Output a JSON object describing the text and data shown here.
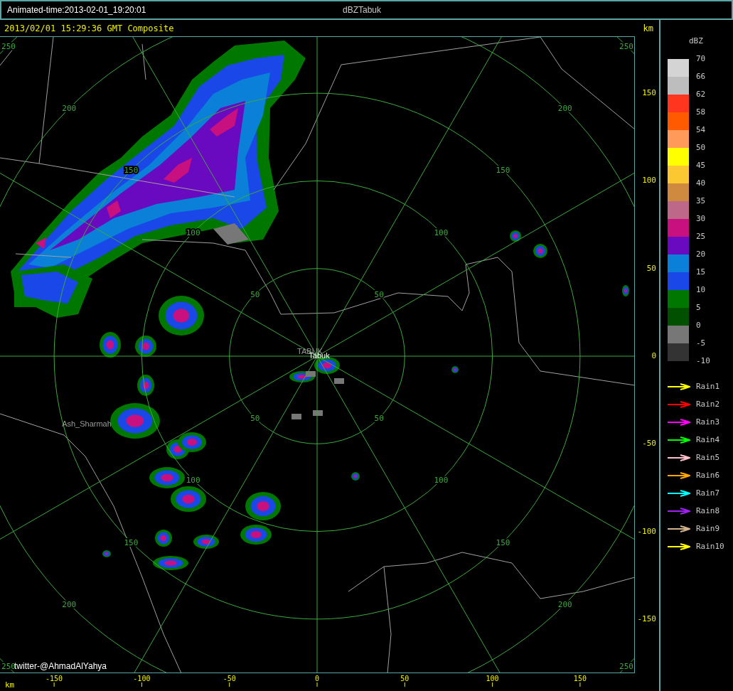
{
  "window": {
    "title": "Animated-time:2013-02-01_19:20:01",
    "product": "dBZTabuk"
  },
  "header": {
    "timestamp": "2013/02/01 15:29:36 GMT Composite",
    "unit": "km"
  },
  "map": {
    "range_rings": [
      {
        "labels": [
          "50",
          "50",
          "50",
          "50"
        ]
      },
      {
        "labels": [
          "100",
          "100",
          "100",
          "100"
        ]
      },
      {
        "labels": [
          "150",
          "150",
          "150",
          "150"
        ]
      },
      {
        "labels": [
          "200",
          "200",
          "200",
          "200"
        ]
      },
      {
        "labels": [
          "250",
          "250",
          "250",
          "250"
        ]
      }
    ],
    "places": [
      {
        "name": "TABUK"
      },
      {
        "name": "Tabuk"
      },
      {
        "name": "Ash_Sharmah"
      }
    ],
    "credit": "twitter-@AhmadAlYahya"
  },
  "x_axis": {
    "unit": "km",
    "ticks": [
      "-150",
      "-100",
      "-50",
      "0",
      "50",
      "100",
      "150"
    ]
  },
  "y_axis": {
    "ticks": [
      "150",
      "100",
      "50",
      "0",
      "-50",
      "-100",
      "-150"
    ]
  },
  "legend": {
    "title": "dBZ",
    "bands": [
      {
        "color": "#d4d4d4"
      },
      {
        "color": "#bdbdbd"
      },
      {
        "color": "#ff3520"
      },
      {
        "color": "#ff5a00"
      },
      {
        "color": "#ff9a5a"
      },
      {
        "color": "#ffff00"
      },
      {
        "color": "#fcc832"
      },
      {
        "color": "#d08a40"
      },
      {
        "color": "#bd6888"
      },
      {
        "color": "#c8107e"
      },
      {
        "color": "#6a0ac0"
      },
      {
        "color": "#0a80d8"
      },
      {
        "color": "#1a48e8"
      },
      {
        "color": "#007800"
      },
      {
        "color": "#005000"
      },
      {
        "color": "#777777"
      },
      {
        "color": "#333333"
      }
    ],
    "labels": [
      "70",
      "66",
      "62",
      "58",
      "54",
      "50",
      "45",
      "40",
      "35",
      "30",
      "25",
      "20",
      "15",
      "10",
      "5",
      "0",
      "-5",
      "-10"
    ]
  },
  "rain_tracks": [
    {
      "label": "Rain1",
      "color": "#ffff00"
    },
    {
      "label": "Rain2",
      "color": "#ff0000"
    },
    {
      "label": "Rain3",
      "color": "#ff00ff"
    },
    {
      "label": "Rain4",
      "color": "#00ff00"
    },
    {
      "label": "Rain5",
      "color": "#ffc0cb"
    },
    {
      "label": "Rain6",
      "color": "#ffa500"
    },
    {
      "label": "Rain7",
      "color": "#00ffff"
    },
    {
      "label": "Rain8",
      "color": "#a020f0"
    },
    {
      "label": "Rain9",
      "color": "#d2b48c"
    },
    {
      "label": "Rain10",
      "color": "#ffff00"
    }
  ]
}
